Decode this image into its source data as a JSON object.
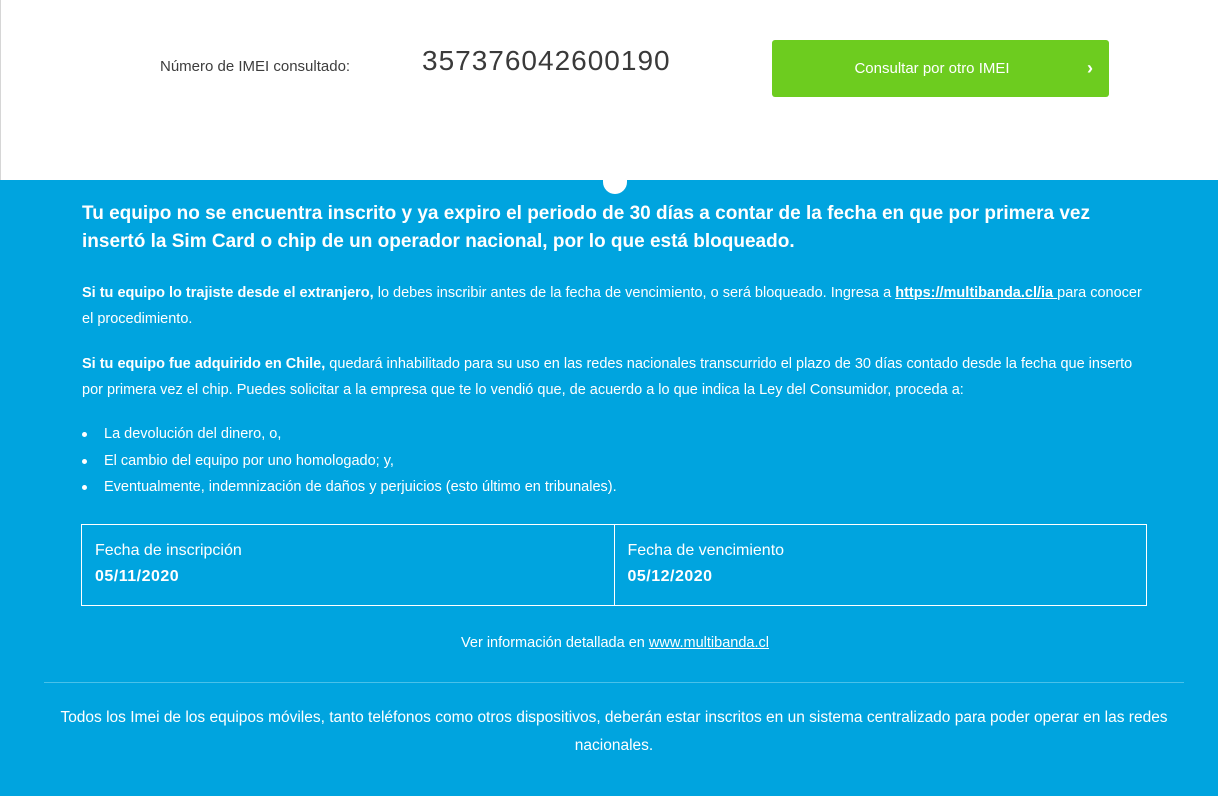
{
  "imei": {
    "label": "Número de IMEI consultado:",
    "value": "357376042600190"
  },
  "button": {
    "label": "Consultar por otro IMEI",
    "chevron": "›"
  },
  "headline": "Tu equipo no se encuentra inscrito y ya expiro el periodo de 30 días a contar de la fecha en que por primera vez insertó la Sim Card o chip de un operador nacional, por lo que está bloqueado.",
  "paragraph1": {
    "bold": "Si tu equipo lo trajiste desde el extranjero,",
    "text": " lo debes inscribir antes de la fecha de vencimiento, o será bloqueado. Ingresa a ",
    "link": "https://multibanda.cl/ia ",
    "after": "para conocer el procedimiento."
  },
  "paragraph2": {
    "bold": "Si tu equipo fue adquirido en Chile,",
    "text": " quedará inhabilitado para su uso en las redes nacionales transcurrido el plazo de 30 días contado desde la fecha que inserto por primera vez el chip. Puedes solicitar a la empresa que te lo vendió que, de acuerdo a lo que indica la Ley del Consumidor, proceda a:"
  },
  "options": [
    "La devolución del dinero, o,",
    "El cambio del equipo por uno homologado; y,",
    "Eventualmente, indemnización de daños y perjuicios (esto último en tribunales)."
  ],
  "dates": {
    "registration_label": "Fecha de inscripción",
    "registration_value": "05/11/2020",
    "expiry_label": "Fecha de vencimiento",
    "expiry_value": "05/12/2020"
  },
  "more_info": {
    "text": "Ver información detallada en ",
    "link": "www.multibanda.cl"
  },
  "footer": "Todos los Imei de los equipos móviles, tanto teléfonos como otros dispositivos, deberán estar inscritos en un sistema centralizado para poder operar en las redes nacionales.",
  "colors": {
    "accent_blue": "#00a4df",
    "button_green": "#6dcc1f"
  }
}
